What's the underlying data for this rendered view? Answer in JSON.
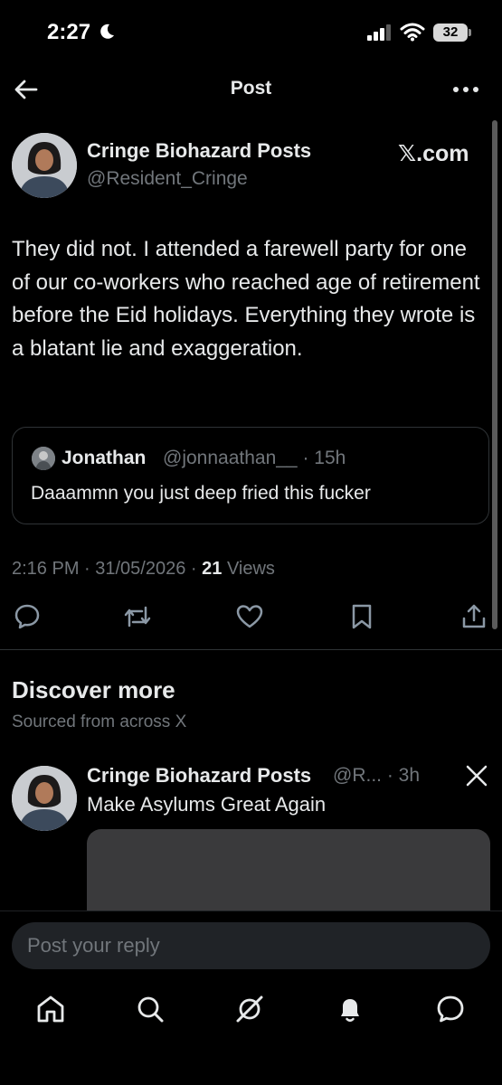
{
  "status_bar": {
    "time": "2:27",
    "battery": "32",
    "icons": [
      "moon-icon",
      "signal-icon",
      "wifi-icon",
      "battery-icon"
    ]
  },
  "header": {
    "title": "Post",
    "back_icon": "arrow-left-icon",
    "more_icon": "more-horizontal-icon"
  },
  "post": {
    "author_name": "Cringe Biohazard Posts",
    "author_handle": "@Resident_Cringe",
    "watermark": "𝕏.com",
    "text": "They did not. I attended a farewell party for one of our co-workers who reached age of retirement before the Eid holidays. Everything they wrote is a blatant lie and exaggeration.",
    "quote": {
      "name": "Jonathan",
      "meta": "@jonnaathan__ · 15h",
      "text": "Daaammn you just deep fried this fucker"
    },
    "meta_prefix": "2:16 PM · 31/05/2026 · ",
    "views_count": "21",
    "views_label": " Views",
    "actions": [
      "reply-icon",
      "repost-icon",
      "like-icon",
      "bookmark-icon",
      "share-icon"
    ]
  },
  "discover": {
    "title": "Discover more",
    "subtitle": "Sourced from across X",
    "item": {
      "name": "Cringe Biohazard Posts",
      "meta": "@R... · 3h",
      "text": "Make Asylums Great Again",
      "badge_icon": "x-logo-icon"
    }
  },
  "reply": {
    "placeholder": "Post your reply"
  },
  "tab_bar": {
    "items": [
      "home-icon",
      "search-icon",
      "grok-icon",
      "notifications-icon",
      "messages-icon"
    ]
  },
  "colors": {
    "background": "#000000",
    "text": "#e7e9ea",
    "secondary_text": "#71767b",
    "border": "#2f3336",
    "input_bg": "#202327"
  }
}
